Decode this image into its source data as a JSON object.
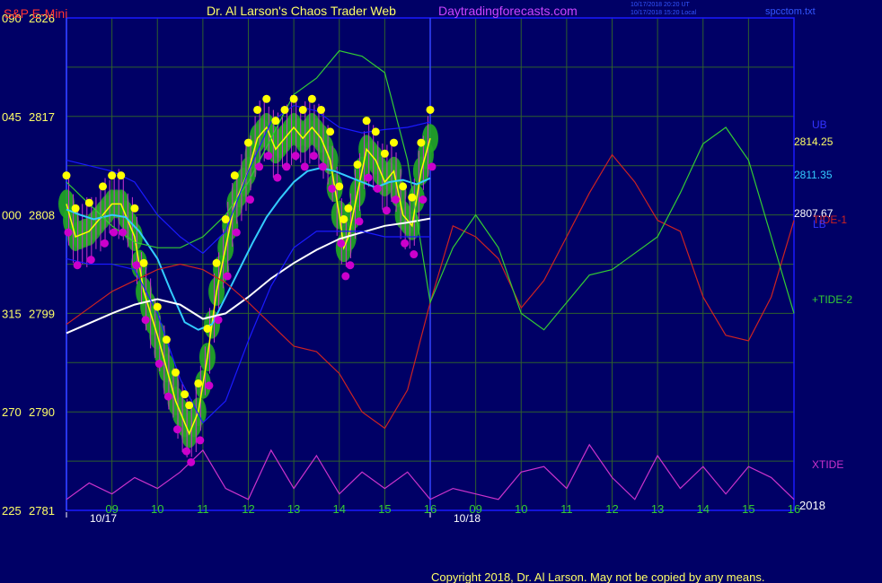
{
  "header": {
    "title_left": "S&P E-Mini",
    "title_center": "Dr. Al Larson's Chaos Trader Web",
    "site": "Daytradingforecasts.com",
    "timestamp_1": "10/17/2018 20:20 UT",
    "timestamp_2": "10/17/2018 15:20 Local",
    "file": "spcctom.txt"
  },
  "footer": {
    "copyright": "Copyright 2018, Dr. Al Larson. May not be copied by any means."
  },
  "colors": {
    "background": "#000066",
    "grid": "#2e5f2e",
    "price": "#ffff00",
    "cyan_avg": "#33ccff",
    "white_avg": "#ffffff",
    "tide1": "#cc2222",
    "tide2": "#33cc33",
    "xtide": "#cc33cc",
    "bands": "#1a1aff",
    "high_dots": "#ffff00",
    "low_dots": "#cc00cc",
    "envelope": "#22aa22"
  },
  "chart_data": {
    "type": "line",
    "title": "S&P E-Mini",
    "y_axis": {
      "left_ticks": [
        "090",
        "045",
        "000",
        "315",
        "270",
        "225"
      ],
      "price_ticks": [
        2826,
        2817,
        2808,
        2799,
        2790,
        2781
      ],
      "ylim": [
        2781,
        2826
      ]
    },
    "x_axis": {
      "hour_ticks": [
        "09",
        "10",
        "11",
        "12",
        "13",
        "14",
        "15",
        "16",
        "09",
        "10",
        "11",
        "12",
        "13",
        "14",
        "15",
        "16"
      ],
      "date_labels": [
        "10/17",
        "10/18"
      ],
      "year_label": "2018"
    },
    "right_labels": [
      {
        "text": "UB",
        "color": "#3333ff"
      },
      {
        "text": "2814.25",
        "color": "#ffff66"
      },
      {
        "text": "2811.35",
        "color": "#33ccff"
      },
      {
        "text": "2807.67",
        "color": "#ffffff"
      },
      {
        "text": "TIDE-1",
        "color": "#cc2222"
      },
      {
        "text": "LB",
        "color": "#3333ff"
      },
      {
        "text": "+TIDE-2",
        "color": "#33cc33"
      },
      {
        "text": "XTIDE",
        "color": "#cc33cc"
      }
    ],
    "series": [
      {
        "name": "",
        "color": "#ffff00",
        "x": [
          8.0,
          8.2,
          8.5,
          8.8,
          9.0,
          9.2,
          9.5,
          9.7,
          10.0,
          10.2,
          10.4,
          10.6,
          10.7,
          10.9,
          11.1,
          11.3,
          11.5,
          11.7,
          12.0,
          12.2,
          12.4,
          12.6,
          12.8,
          13.0,
          13.2,
          13.4,
          13.6,
          13.8,
          14.0,
          14.1,
          14.2,
          14.4,
          14.6,
          14.8,
          15.0,
          15.2,
          15.4,
          15.6,
          15.8,
          16.0
        ],
        "y": [
          2809,
          2806,
          2806.5,
          2808,
          2809,
          2809,
          2806,
          2801,
          2797,
          2794,
          2791,
          2789,
          2788,
          2790,
          2795,
          2801,
          2805,
          2809,
          2812,
          2815,
          2816,
          2814,
          2815,
          2816,
          2815,
          2816,
          2815,
          2813,
          2808,
          2805,
          2806,
          2810,
          2814,
          2813,
          2811,
          2812,
          2808,
          2807,
          2812,
          2815
        ]
      },
      {
        "name": "",
        "color": "#33ccff",
        "x": [
          8.0,
          8.3,
          8.6,
          9.0,
          9.3,
          9.6,
          10.0,
          10.3,
          10.6,
          10.9,
          11.2,
          11.5,
          11.8,
          12.1,
          12.4,
          12.7,
          13.0,
          13.3,
          13.6,
          13.9,
          14.2,
          14.5,
          14.8,
          15.1,
          15.4,
          15.7,
          16.0
        ],
        "y": [
          2808.5,
          2808,
          2807.6,
          2808,
          2807.8,
          2806.5,
          2804,
          2801,
          2798.2,
          2797.5,
          2798,
          2800.5,
          2803,
          2805.5,
          2807.8,
          2809.5,
          2811,
          2812,
          2812.3,
          2812,
          2811.5,
          2811,
          2810.5,
          2811,
          2811.2,
          2810.8,
          2811.35
        ]
      },
      {
        "name": "",
        "color": "#ffffff",
        "x": [
          8.0,
          8.5,
          9.0,
          9.5,
          10.0,
          10.5,
          11.0,
          11.5,
          12.0,
          12.5,
          13.0,
          13.5,
          14.0,
          14.5,
          15.0,
          15.5,
          16.0
        ],
        "y": [
          2797.2,
          2798.1,
          2799,
          2799.8,
          2800.3,
          2799.8,
          2798.5,
          2799,
          2800.5,
          2802.2,
          2803.6,
          2804.8,
          2805.8,
          2806.4,
          2807,
          2807.3,
          2807.67
        ]
      },
      {
        "name": "TIDE-1",
        "color": "#cc2222",
        "x": [
          8.0,
          8.5,
          9.0,
          9.5,
          10.0,
          10.5,
          11.0,
          11.5,
          12.0,
          12.5,
          13.0,
          13.5,
          14.0,
          14.5,
          15.0,
          15.5,
          16.0,
          16.5,
          17.0,
          17.5,
          18.0,
          18.5,
          19.0,
          19.5,
          20.0,
          20.5,
          21.0,
          21.5,
          22.0,
          22.5,
          23.0,
          23.5,
          24.0
        ],
        "y": [
          2798,
          2799.5,
          2801,
          2802,
          2803,
          2803.5,
          2803,
          2801.8,
          2800,
          2798,
          2796,
          2795.5,
          2793.5,
          2790,
          2788.5,
          2792,
          2800,
          2807,
          2806,
          2804,
          2799.5,
          2802,
          2806,
          2810,
          2813.5,
          2811,
          2807.5,
          2806.5,
          2800.5,
          2797,
          2796.5,
          2800.5,
          2807.5
        ]
      },
      {
        "name": "+TIDE-2",
        "color": "#33cc33",
        "x": [
          8.0,
          8.5,
          9.0,
          9.5,
          10.0,
          10.5,
          11.0,
          11.5,
          12.0,
          12.5,
          13.0,
          13.5,
          14.0,
          14.5,
          15.0,
          15.5,
          16.0,
          16.5,
          17.0,
          17.5,
          18.0,
          18.5,
          19.0,
          19.5,
          20.0,
          20.5,
          21.0,
          21.5,
          22.0,
          22.5,
          23.0,
          23.5,
          24.0
        ],
        "y": [
          2811,
          2809,
          2807,
          2805.5,
          2805,
          2805,
          2806,
          2808,
          2811,
          2815,
          2819,
          2820.5,
          2823,
          2822.5,
          2821,
          2813,
          2800,
          2805,
          2808,
          2805,
          2799,
          2797.5,
          2800,
          2802.5,
          2803,
          2804.5,
          2806,
          2810,
          2814.5,
          2816,
          2813,
          2806,
          2799
        ]
      },
      {
        "name": "XTIDE",
        "color": "#cc33cc",
        "x": [
          8.0,
          8.5,
          9.0,
          9.5,
          10.0,
          10.5,
          11.0,
          11.5,
          12.0,
          12.5,
          13.0,
          13.5,
          14.0,
          14.5,
          15.0,
          15.5,
          16.0,
          16.5,
          17.0,
          17.5,
          18.0,
          18.5,
          19.0,
          19.5,
          20.0,
          20.5,
          21.0,
          21.5,
          22.0,
          22.5,
          23.0,
          23.5,
          24.0
        ],
        "y": [
          2782,
          2783.5,
          2782.5,
          2784,
          2783,
          2784.5,
          2786.5,
          2783,
          2782,
          2786.5,
          2783,
          2786,
          2782.5,
          2784.5,
          2783,
          2784.5,
          2782,
          2783,
          2782.5,
          2782,
          2784.5,
          2785,
          2783,
          2787,
          2784,
          2782,
          2786,
          2783,
          2785,
          2782.5,
          2785,
          2784,
          2782
        ]
      },
      {
        "name": "UB",
        "color": "#1a1aff",
        "x": [
          8.0,
          8.5,
          9.0,
          9.5,
          10.0,
          10.5,
          11.0,
          11.5,
          12.0,
          12.5,
          13.0,
          13.5,
          14.0,
          14.5,
          15.0,
          15.5,
          16.0
        ],
        "y": [
          2813,
          2812.5,
          2812,
          2811,
          2808,
          2806,
          2804.5,
          2806.5,
          2812,
          2816.5,
          2818,
          2817.5,
          2816,
          2815.5,
          2815.8,
          2816,
          2816.5
        ]
      },
      {
        "name": "LB",
        "color": "#1a1aff",
        "x": [
          8.0,
          8.5,
          9.0,
          9.5,
          10.0,
          10.5,
          11.0,
          11.5,
          12.0,
          12.5,
          13.0,
          13.5,
          14.0,
          14.5,
          15.0,
          15.5,
          16.0
        ],
        "y": [
          2804,
          2803.5,
          2803.5,
          2803,
          2799,
          2793,
          2789,
          2791,
          2796.5,
          2801.5,
          2805,
          2806.5,
          2806.5,
          2806.5,
          2806,
          2806,
          2806
        ]
      }
    ],
    "vertical_markers": [
      8.0,
      16.0
    ],
    "grid": true
  }
}
